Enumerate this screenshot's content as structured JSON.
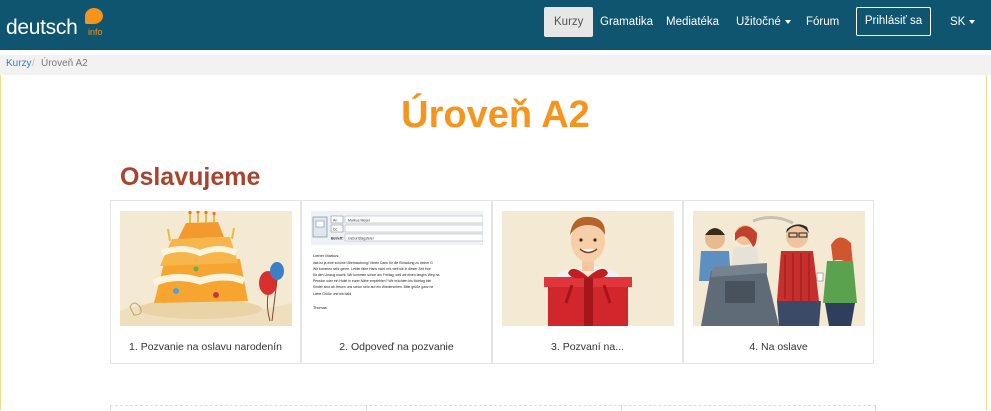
{
  "brand": {
    "name": "deutsch",
    "suffix": "info"
  },
  "nav": {
    "items": [
      "Kurzy",
      "Gramatika",
      "Mediatéka",
      "Užitočné",
      "Fórum"
    ],
    "login": "Prihlásiť sa",
    "language": "SK"
  },
  "breadcrumb": {
    "root": "Kurzy",
    "separator": "/",
    "current": "Úroveň A2"
  },
  "page": {
    "title": "Úroveň A2",
    "section": "Oslavujeme"
  },
  "cards": [
    {
      "caption": "1. Pozvanie na oslavu narodenín",
      "icon": "birthday-cake-icon"
    },
    {
      "caption": "2. Odpoveď na pozvanie",
      "icon": "email-letter-icon"
    },
    {
      "caption": "3. Pozvaní na...",
      "icon": "gift-box-icon"
    },
    {
      "caption": "4. Na oslave",
      "icon": "party-guests-icon"
    }
  ],
  "email": {
    "to_label": "An",
    "to_value": "Markus Meyer",
    "cc_label": "Cc",
    "subject_label": "Betreff:",
    "subject_value": "Geburtstagsfeier",
    "greeting": "Lieber Markus,",
    "lines": [
      "das ist ja eine schöne Überraschung! Vielen Dank für die Einladung zu deiner G",
      "Wir kommen sehr gerne. Leider fährt Hans nicht mit, weil sie in dieser Zeit ihre",
      "für den Umzug macht. Wir kommen schon am Freitag, weil wir einen langen Weg ha",
      "Pension oder ein Hotel in eurer Nähe empfehlen? Wir möchten bis Montag blei",
      "Kinder sind ich freuen uns schon sehr auf ein Wiedersehen. Bitte grüße ganz he",
      "Liebe Grüße und bis bald"
    ],
    "signature": "Thomas"
  },
  "colors": {
    "topbar": "#0f5570",
    "title": "#f7941d",
    "section": "#a8432e",
    "link": "#3a7bc8"
  }
}
